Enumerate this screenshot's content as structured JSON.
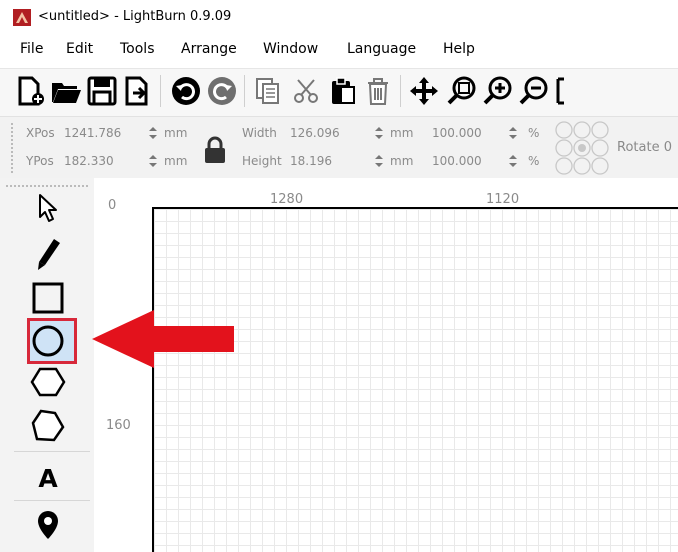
{
  "window": {
    "title": "<untitled> - LightBurn 0.9.09"
  },
  "menu": {
    "items": [
      "File",
      "Edit",
      "Tools",
      "Arrange",
      "Window",
      "Language",
      "Help"
    ]
  },
  "toolbar": {
    "icons": [
      "new-file-icon",
      "open-folder-icon",
      "save-icon",
      "import-icon",
      "undo-icon",
      "redo-icon",
      "copy-icon",
      "cut-icon",
      "paste-icon",
      "delete-icon",
      "move-icon",
      "zoom-frame-icon",
      "zoom-in-icon",
      "zoom-out-icon"
    ]
  },
  "numeric": {
    "xpos_label": "XPos",
    "xpos_value": "1241.786",
    "ypos_label": "YPos",
    "ypos_value": "182.330",
    "unit_mm": "mm",
    "width_label": "Width",
    "width_value": "126.096",
    "height_label": "Height",
    "height_value": "18.196",
    "scale_w": "100.000",
    "scale_h": "100.000",
    "unit_pct": "%",
    "rotate_label": "Rotate 0"
  },
  "tools": {
    "items": [
      "select-tool",
      "edit-nodes-tool",
      "rectangle-tool",
      "ellipse-tool",
      "polygon-tool",
      "pentagon-tool",
      "text-tool",
      "position-laser-tool"
    ],
    "text_tool_glyph": "A",
    "highlighted": "ellipse-tool"
  },
  "rulers": {
    "top_left_value": "0",
    "x_label_1": "1280",
    "x_label_2": "1120",
    "y_label_1": "160"
  },
  "colors": {
    "highlight_border": "#d7283a",
    "arrow": "#e3121c",
    "selected_fill": "#cfe3f6"
  }
}
